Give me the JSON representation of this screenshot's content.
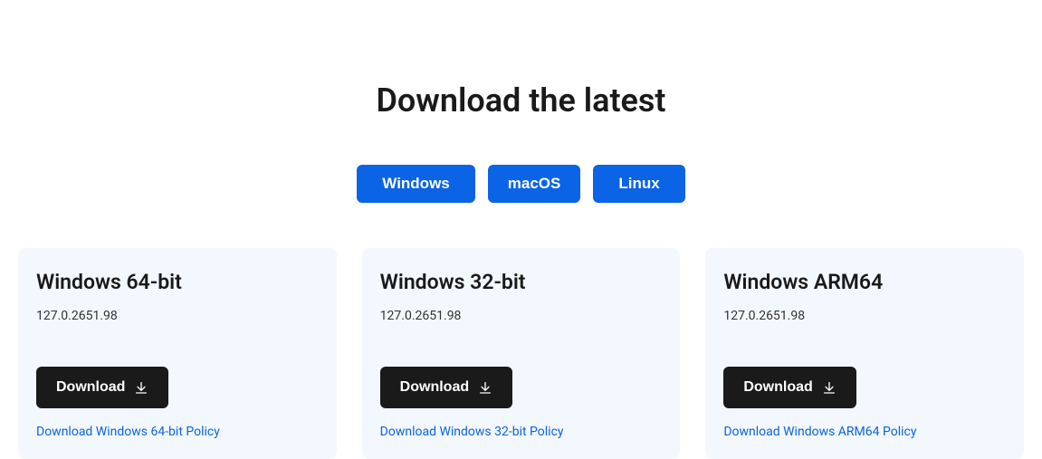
{
  "title": "Download the latest",
  "tabs": [
    {
      "label": "Windows"
    },
    {
      "label": "macOS"
    },
    {
      "label": "Linux"
    }
  ],
  "cards": [
    {
      "title": "Windows 64-bit",
      "version": "127.0.2651.98",
      "button_label": "Download",
      "policy_link": "Download Windows 64-bit Policy"
    },
    {
      "title": "Windows 32-bit",
      "version": "127.0.2651.98",
      "button_label": "Download",
      "policy_link": "Download Windows 32-bit Policy"
    },
    {
      "title": "Windows ARM64",
      "version": "127.0.2651.98",
      "button_label": "Download",
      "policy_link": "Download Windows ARM64 Policy"
    }
  ]
}
